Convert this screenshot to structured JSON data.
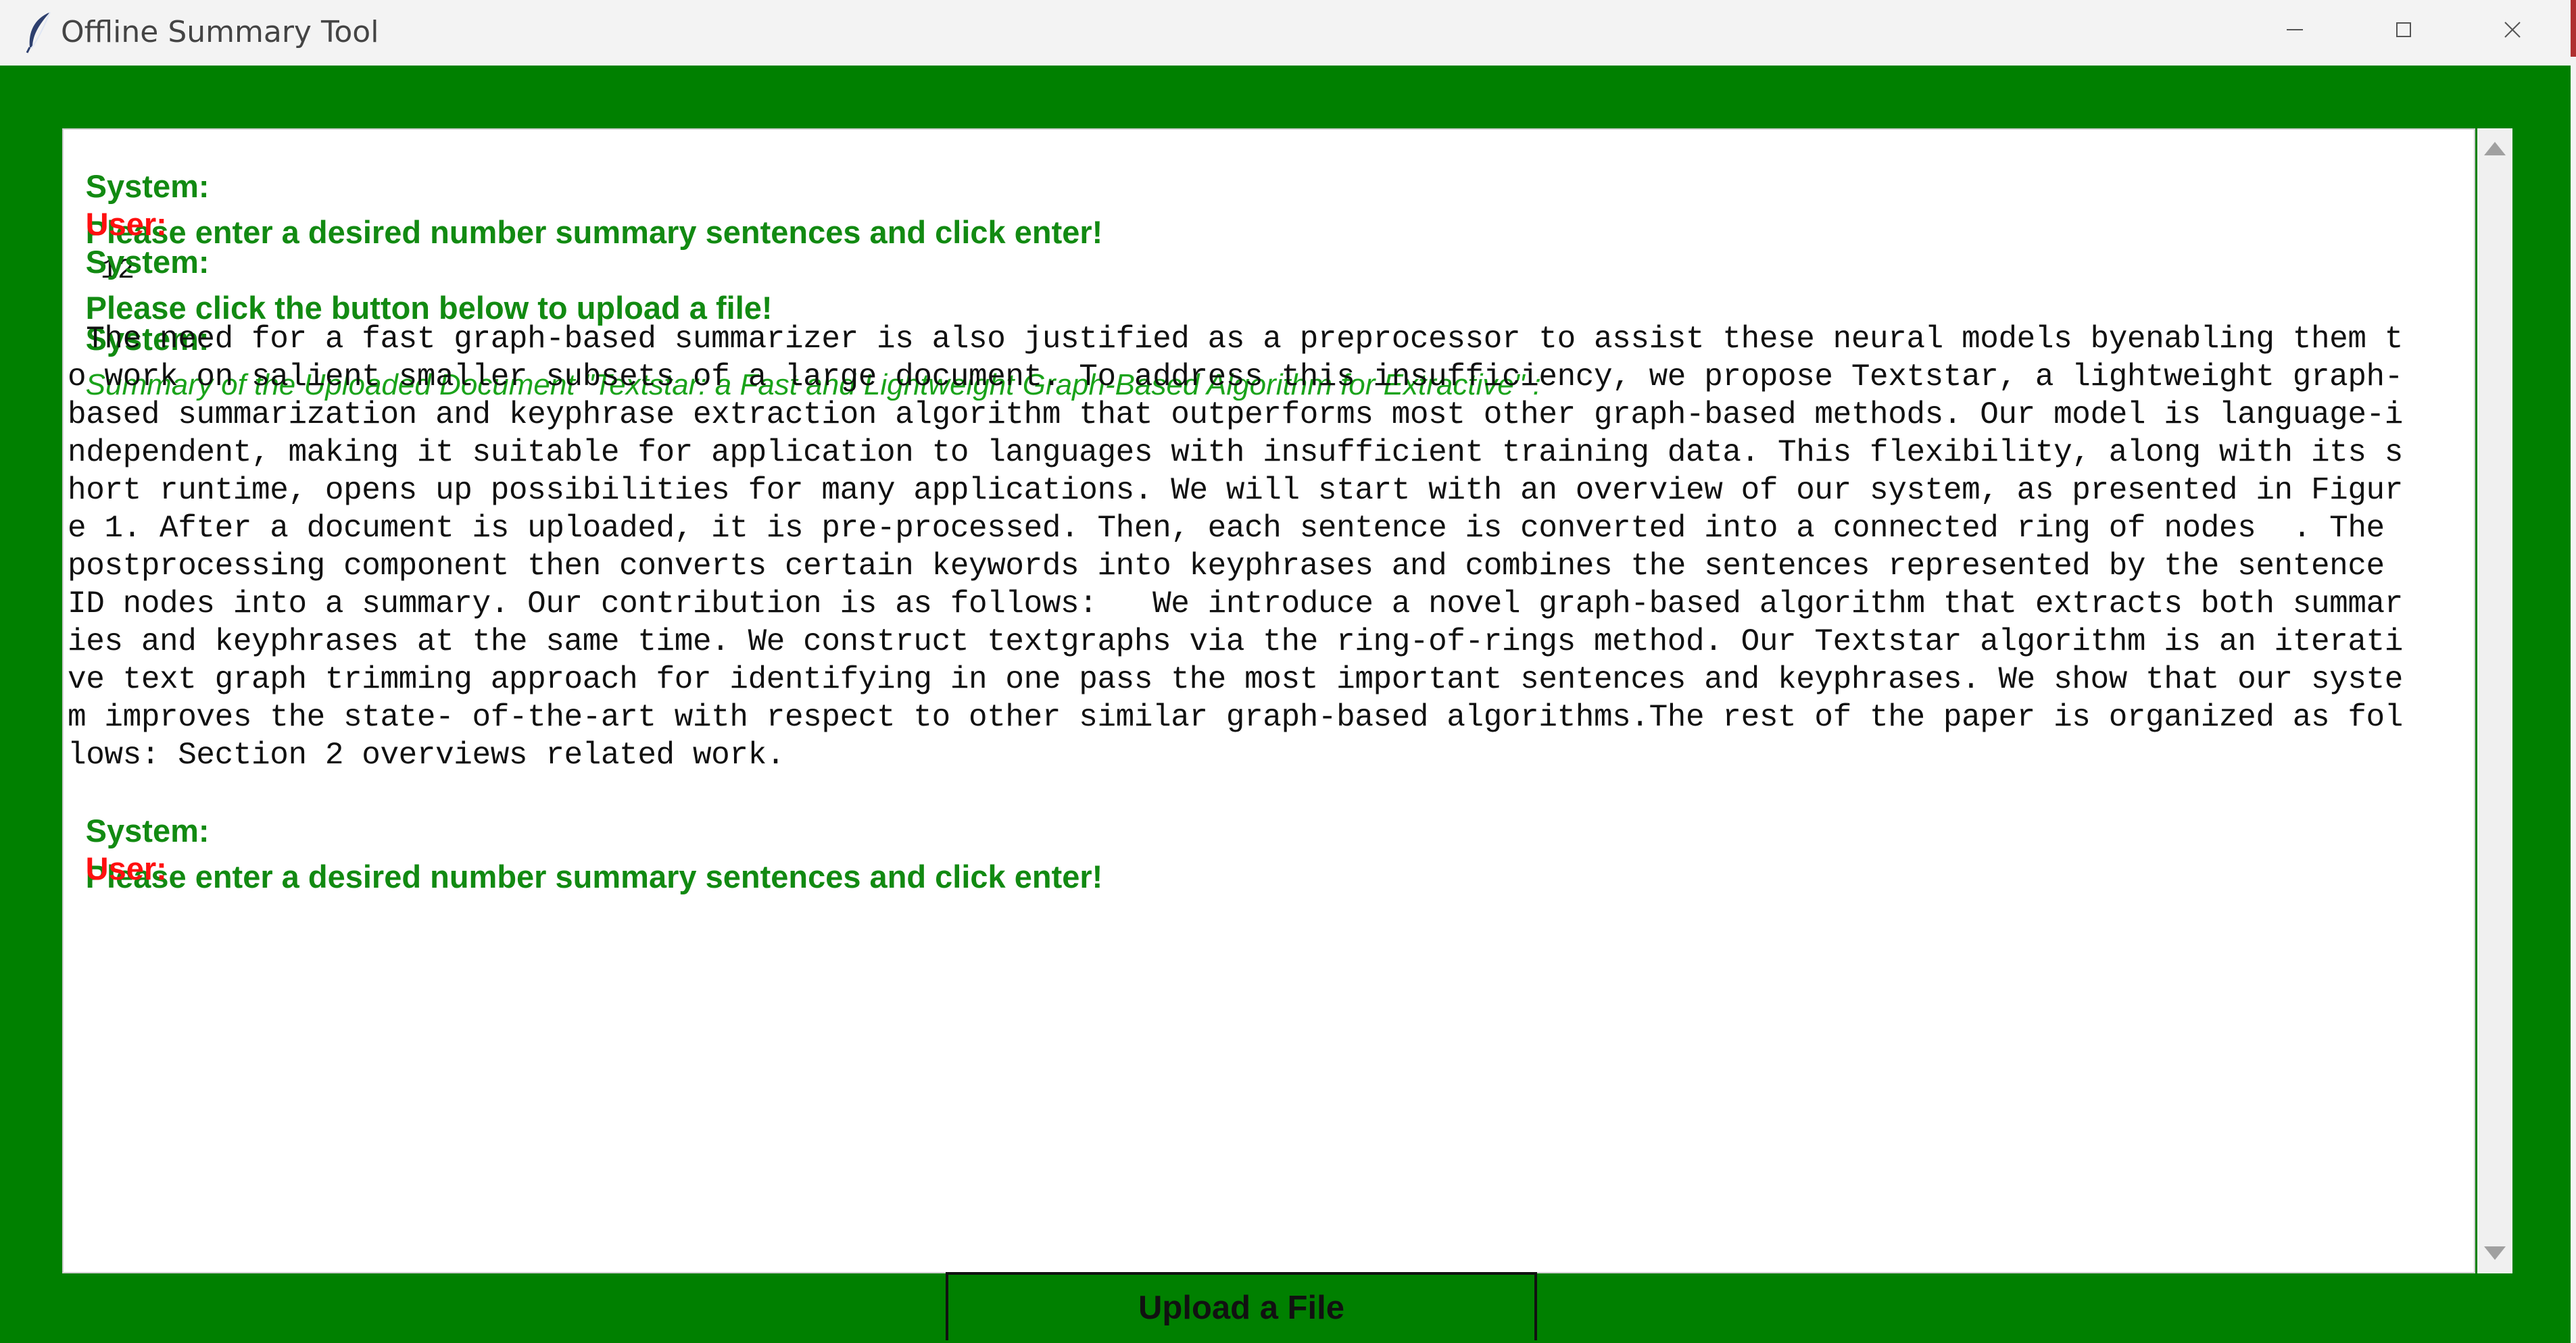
{
  "window": {
    "title": "Offline Summary Tool",
    "app_icon": "feather-icon",
    "controls": [
      "minimize-icon",
      "maximize-icon",
      "close-icon"
    ]
  },
  "colors": {
    "frame_bg": "#008000",
    "system_text": "#128a12",
    "user_text": "#ff1010",
    "textbox_bg": "#ffffff"
  },
  "chat": {
    "line1_sys_label": "System:",
    "line1_sys_text": "Please enter a desired number summary sentences and click enter!",
    "line2_user_label": "User:",
    "line2_user_value": "12",
    "line3_sys_label": "System:",
    "line3_sys_text": "Please click the button below to upload a file!",
    "line4_sys_label": "System:",
    "line4_summary_title": "Summary of the Uploaded Document \"Textstar: a Fast and Lightweight Graph-Based Algorithm for Extractive\" :",
    "summary_lines": [
      " The need for a fast graph-based summarizer is also justified as a preprocessor to assist these neural models byenabling them t",
      "o work on salient smaller subsets of a large document. To address this insufficiency, we propose Textstar, a lightweight graph-",
      "based summarization and keyphrase extraction algorithm that outperforms most other graph-based methods. Our model is language-i",
      "ndependent, making it suitable for application to languages with insufficient training data. This flexibility, along with its s",
      "hort runtime, opens up possibilities for many applications. We will start with an overview of our system, as presented in Figur",
      "e 1. After a document is uploaded, it is pre-processed. Then, each sentence is converted into a connected ring of nodes  . The",
      "postprocessing component then converts certain keywords into keyphrases and combines the sentences represented by the sentence",
      "ID nodes into a summary. Our contribution is as follows:   We introduce a novel graph-based algorithm that extracts both summar",
      "ies and keyphrases at the same time. We construct textgraphs via the ring-of-rings method. Our Textstar algorithm is an iterati",
      "ve text graph trimming approach for identifying in one pass the most important sentences and keyphrases. We show that our syste",
      "m improves the state- of-the-art with respect to other similar graph-based algorithms.The rest of the paper is organized as fol",
      "lows: Section 2 overviews related work."
    ],
    "line5_sys_label": "System:",
    "line5_sys_text": "Please enter a desired number summary sentences and click enter!",
    "line6_user_label": "User:"
  },
  "upload_button": {
    "label": "Upload a File"
  }
}
